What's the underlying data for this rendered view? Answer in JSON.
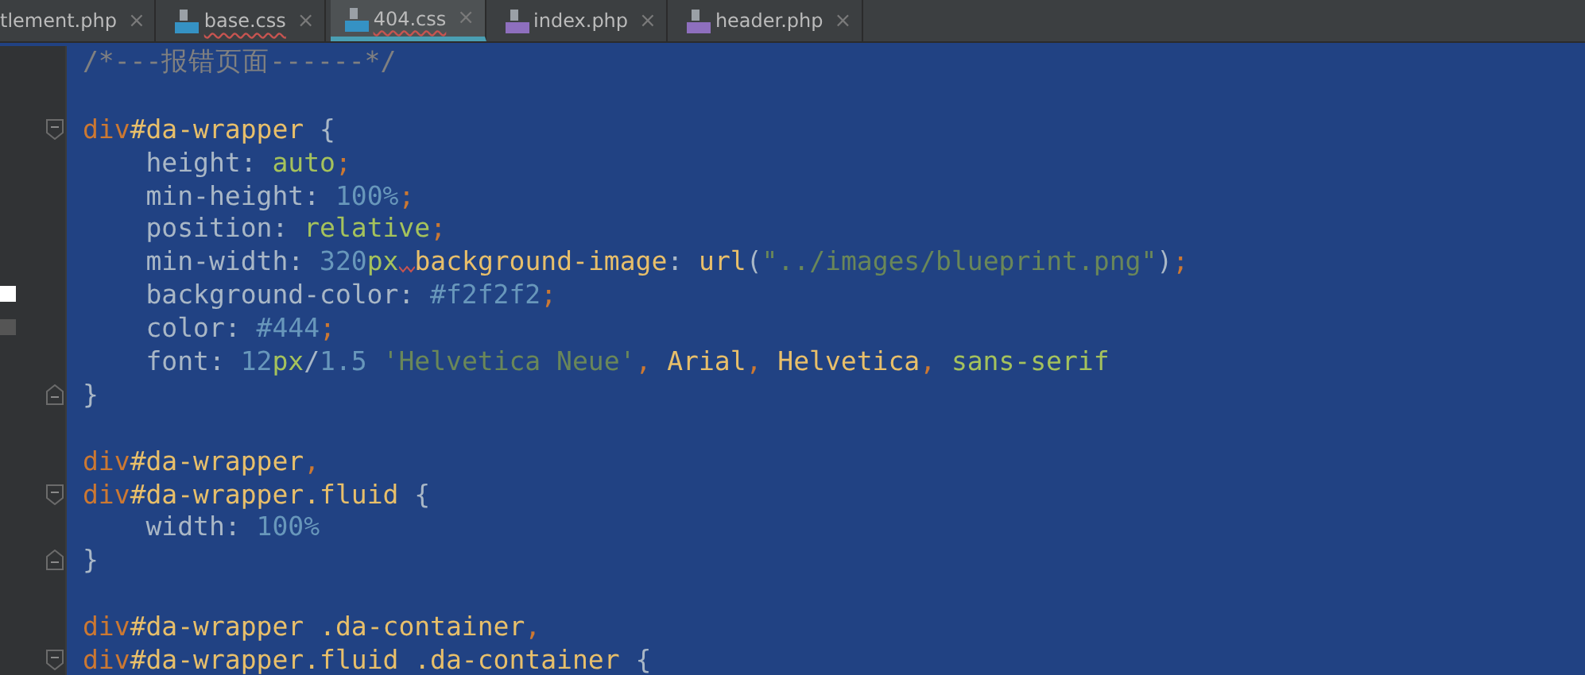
{
  "tabs": [
    {
      "label": "tlement.php",
      "selected": false,
      "error": false,
      "close": "×"
    },
    {
      "label": "base.css",
      "kind": "css",
      "selected": false,
      "error": true,
      "close": "×"
    },
    {
      "label": "404.css",
      "kind": "css",
      "selected": true,
      "error": true,
      "close": "×"
    },
    {
      "label": "index.php",
      "kind": "php",
      "selected": false,
      "error": false,
      "close": "×"
    },
    {
      "label": "header.php",
      "kind": "php",
      "selected": false,
      "error": false,
      "close": "×"
    }
  ],
  "lines": [
    {
      "fold_start": false,
      "fold_end": false,
      "tokens": [
        {
          "kind": "comment",
          "text": "/*---报错页面------*/"
        }
      ]
    },
    {
      "fold_start": false,
      "fold_end": false
    },
    {
      "fold_start": true,
      "fold_end": false,
      "tokens": [
        {
          "kind": "tag",
          "text": "div"
        },
        {
          "kind": "sel",
          "text": "#da-wrapper"
        },
        {
          "kind": "plain",
          "text": " {"
        }
      ]
    },
    {
      "fold_start": false,
      "fold_end": false,
      "tokens": [
        {
          "kind": "plain",
          "text": "    height: "
        },
        {
          "kind": "kw",
          "text": "auto"
        },
        {
          "kind": "punct",
          "text": ";"
        }
      ]
    },
    {
      "fold_start": false,
      "fold_end": false,
      "tokens": [
        {
          "kind": "plain",
          "text": "    min-height: "
        },
        {
          "kind": "num",
          "text": "100%"
        },
        {
          "kind": "punct",
          "text": ";"
        }
      ]
    },
    {
      "fold_start": false,
      "fold_end": false,
      "tokens": [
        {
          "kind": "plain",
          "text": "    position: "
        },
        {
          "kind": "kw",
          "text": "relative"
        },
        {
          "kind": "punct",
          "text": ";"
        }
      ]
    },
    {
      "fold_start": false,
      "fold_end": false,
      "tokens": [
        {
          "kind": "plain",
          "text": "    min-width: "
        },
        {
          "kind": "num",
          "text": "320"
        },
        {
          "kind": "kw",
          "text": "px",
          "error_after": true
        },
        {
          "kind": "sel",
          "text": "background-image"
        },
        {
          "kind": "plain",
          "text": ": "
        },
        {
          "kind": "sel",
          "text": "url"
        },
        {
          "kind": "plain",
          "text": "("
        },
        {
          "kind": "str",
          "text": "\"../images/blueprint.png\""
        },
        {
          "kind": "plain",
          "text": ")"
        },
        {
          "kind": "punct",
          "text": ";"
        }
      ]
    },
    {
      "fold_start": false,
      "fold_end": false,
      "color": "#ffffff",
      "tokens": [
        {
          "kind": "plain",
          "text": "    background-color: "
        },
        {
          "kind": "num",
          "text": "#f2f2f2"
        },
        {
          "kind": "punct",
          "text": ";"
        }
      ]
    },
    {
      "fold_start": false,
      "fold_end": false,
      "color": "#555555",
      "tokens": [
        {
          "kind": "plain",
          "text": "    color: "
        },
        {
          "kind": "num",
          "text": "#444"
        },
        {
          "kind": "punct",
          "text": ";"
        }
      ]
    },
    {
      "fold_start": false,
      "fold_end": false,
      "tokens": [
        {
          "kind": "plain",
          "text": "    font: "
        },
        {
          "kind": "num",
          "text": "12"
        },
        {
          "kind": "kw",
          "text": "px"
        },
        {
          "kind": "plain",
          "text": "/"
        },
        {
          "kind": "num",
          "text": "1.5 "
        },
        {
          "kind": "str",
          "text": "'Helvetica Neue'"
        },
        {
          "kind": "punct",
          "text": ", "
        },
        {
          "kind": "sel",
          "text": "Arial"
        },
        {
          "kind": "punct",
          "text": ", "
        },
        {
          "kind": "sel",
          "text": "Helvetica"
        },
        {
          "kind": "punct",
          "text": ", "
        },
        {
          "kind": "kw",
          "text": "sans-serif"
        }
      ]
    },
    {
      "fold_start": false,
      "fold_end": true,
      "tokens": [
        {
          "kind": "plain",
          "text": "}"
        }
      ]
    },
    {
      "fold_start": false,
      "fold_end": false
    },
    {
      "fold_start": false,
      "fold_end": false,
      "tokens": [
        {
          "kind": "tag",
          "text": "div"
        },
        {
          "kind": "sel",
          "text": "#da-wrapper"
        },
        {
          "kind": "punct",
          "text": ","
        }
      ]
    },
    {
      "fold_start": true,
      "fold_end": false,
      "tokens": [
        {
          "kind": "tag",
          "text": "div"
        },
        {
          "kind": "sel",
          "text": "#da-wrapper.fluid"
        },
        {
          "kind": "plain",
          "text": " {"
        }
      ]
    },
    {
      "fold_start": false,
      "fold_end": false,
      "tokens": [
        {
          "kind": "plain",
          "text": "    width: "
        },
        {
          "kind": "num",
          "text": "100%"
        }
      ]
    },
    {
      "fold_start": false,
      "fold_end": true,
      "tokens": [
        {
          "kind": "plain",
          "text": "}"
        }
      ]
    },
    {
      "fold_start": false,
      "fold_end": false
    },
    {
      "fold_start": false,
      "fold_end": false,
      "tokens": [
        {
          "kind": "tag",
          "text": "div"
        },
        {
          "kind": "sel",
          "text": "#da-wrapper .da-container"
        },
        {
          "kind": "punct",
          "text": ","
        }
      ]
    },
    {
      "fold_start": true,
      "fold_end": false,
      "tokens": [
        {
          "kind": "tag",
          "text": "div"
        },
        {
          "kind": "sel",
          "text": "#da-wrapper.fluid .da-container"
        },
        {
          "kind": "plain",
          "text": " {"
        }
      ]
    }
  ]
}
